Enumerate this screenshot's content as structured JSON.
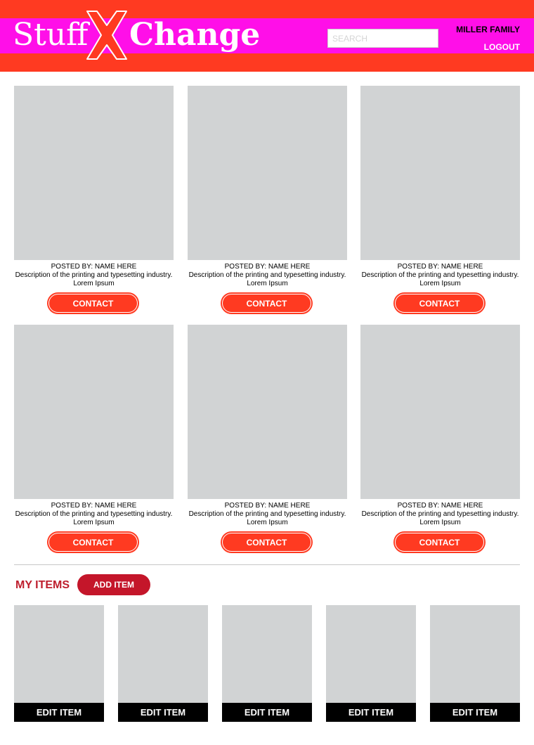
{
  "brand": {
    "logo_left": "Stuff",
    "logo_right": "Change",
    "primary_color": "#ff3a21",
    "accent_color": "#ff0fe8"
  },
  "header": {
    "search_placeholder": "SEARCH",
    "user_name": "MILLER FAMILY",
    "logout_label": "LOGOUT"
  },
  "listings": [
    {
      "posted_by": "POSTED BY: NAME HERE",
      "description": "Description of the printing and typesetting industry. Lorem Ipsum",
      "contact_label": "CONTACT"
    },
    {
      "posted_by": "POSTED BY: NAME HERE",
      "description": "Description of the printing and typesetting industry. Lorem Ipsum",
      "contact_label": "CONTACT"
    },
    {
      "posted_by": "POSTED BY: NAME HERE",
      "description": "Description of the printing and typesetting industry. Lorem Ipsum",
      "contact_label": "CONTACT"
    },
    {
      "posted_by": "POSTED BY: NAME HERE",
      "description": "Description of the printing and typesetting industry. Lorem Ipsum",
      "contact_label": "CONTACT"
    },
    {
      "posted_by": "POSTED BY: NAME HERE",
      "description": "Description of the printing and typesetting industry. Lorem Ipsum",
      "contact_label": "CONTACT"
    },
    {
      "posted_by": "POSTED BY: NAME HERE",
      "description": "Description of the printing and typesetting industry. Lorem Ipsum",
      "contact_label": "CONTACT"
    }
  ],
  "my_items": {
    "title": "MY ITEMS",
    "add_label": "ADD ITEM",
    "items": [
      {
        "edit_label": "EDIT ITEM"
      },
      {
        "edit_label": "EDIT ITEM"
      },
      {
        "edit_label": "EDIT ITEM"
      },
      {
        "edit_label": "EDIT ITEM"
      },
      {
        "edit_label": "EDIT ITEM"
      }
    ]
  }
}
